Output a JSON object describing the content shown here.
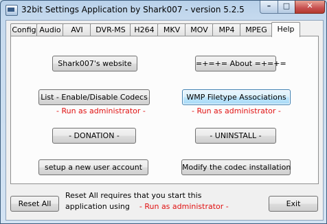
{
  "window": {
    "title": "32bit Settings Application by Shark007 - version 5.2.5",
    "buttons": {
      "minimize": "–",
      "maximize": "□",
      "close": "✕"
    }
  },
  "tabs": [
    "Config",
    "Audio",
    "AVI",
    "DVR-MS",
    "H264",
    "MKV",
    "MOV",
    "MP4",
    "MPEG",
    "Help"
  ],
  "active_tab": "Help",
  "help_panel": {
    "website_button": "Shark007's website",
    "about_button": "=+=+= About =+=+=",
    "codecs_button": "List - Enable/Disable Codecs",
    "codecs_note": "- Run as administrator -",
    "wmp_button": "WMP Filetype Associations",
    "wmp_note": "- Run as administrator -",
    "donation_button": "- DONATION -",
    "uninstall_button": "- UNINSTALL -",
    "new_user_button": "setup a new user account",
    "modify_button": "Modify the codec installation"
  },
  "footer": {
    "reset_button": "Reset All",
    "reset_note_line1": "Reset All requires that you start this",
    "reset_note_line2_prefix": "application using",
    "reset_note_line2_red": "- Run as administrator -",
    "exit_button": "Exit"
  }
}
